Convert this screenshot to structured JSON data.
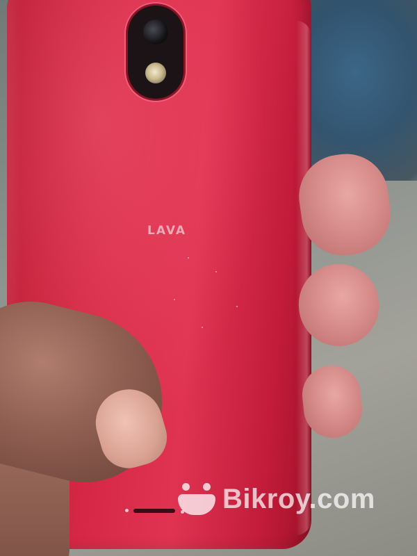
{
  "photo": {
    "brand_logo": "LAVA",
    "watermark_text": "Bikroy.com",
    "watermark_icon": "smiley-bag-icon",
    "colors": {
      "phone_body": "#d62846",
      "watermark": "#ffffff"
    }
  }
}
